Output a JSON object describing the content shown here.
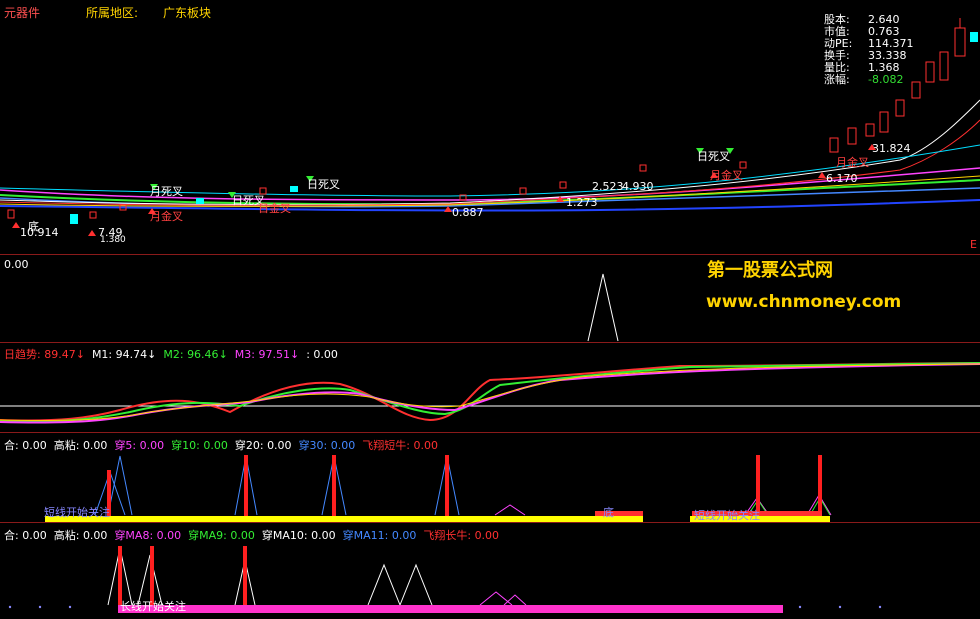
{
  "header": {
    "stock_type": "元器件",
    "region_label": "所属地区:",
    "board": "广东板块"
  },
  "stats": [
    {
      "label": "股本:",
      "value": "2.640",
      "color": "#ffffff"
    },
    {
      "label": "市值:",
      "value": "0.763",
      "color": "#ffffff"
    },
    {
      "label": "动PE:",
      "value": "114.371",
      "color": "#ffffff"
    },
    {
      "label": "换手:",
      "value": "33.338",
      "color": "#ffffff"
    },
    {
      "label": "量比:",
      "value": "1.368",
      "color": "#ffffff"
    },
    {
      "label": "涨幅:",
      "value": "-8.082",
      "color": "#33dd33"
    }
  ],
  "main_chart": {
    "annotations": [
      {
        "text": "月死叉",
        "color": "#ffffff"
      },
      {
        "text": "月金叉",
        "color": "#ff4040"
      },
      {
        "text": "日死叉",
        "color": "#ffffff"
      },
      {
        "text": "日金叉",
        "color": "#ff4040"
      },
      {
        "text": "日死叉",
        "color": "#ffffff"
      },
      {
        "text": "日死叉",
        "color": "#ffffff"
      },
      {
        "text": "月金叉",
        "color": "#ff4040"
      },
      {
        "text": "月金叉",
        "color": "#ff4040"
      },
      {
        "text": "底",
        "color": "#ffffff"
      }
    ],
    "price_labels": [
      "10.914",
      "7.49",
      "1.380",
      "0.887",
      "1.273",
      "2.523",
      "4.930",
      "31.824",
      "6.170"
    ],
    "right_edge_marker": "E"
  },
  "panel1": {
    "value_label": "0.00"
  },
  "watermark": {
    "line1": "第一股票公式网",
    "line2": "www.chnmoney.com"
  },
  "panel2": {
    "items": [
      {
        "label": "日趋势:",
        "value": "89.47",
        "arrow": "↓",
        "color": "#ff3030"
      },
      {
        "label": "M1:",
        "value": "94.74",
        "arrow": "↓",
        "color": "#ffffff"
      },
      {
        "label": "M2:",
        "value": "96.46",
        "arrow": "↓",
        "color": "#33ee33"
      },
      {
        "label": "M3:",
        "value": "97.51",
        "arrow": "↓",
        "color": "#ff44ff"
      },
      {
        "label": ":",
        "value": "0.00",
        "arrow": "",
        "color": "#ffffff"
      }
    ]
  },
  "panel3": {
    "items": [
      {
        "label": "合:",
        "value": "0.00",
        "color": "#ffffff"
      },
      {
        "label": "高粘:",
        "value": "0.00",
        "color": "#ffffff"
      },
      {
        "label": "穿5:",
        "value": "0.00",
        "color": "#ff44ff"
      },
      {
        "label": "穿10:",
        "value": "0.00",
        "color": "#33ee33"
      },
      {
        "label": "穿20:",
        "value": "0.00",
        "color": "#ffffff"
      },
      {
        "label": "穿30:",
        "value": "0.00",
        "color": "#4488ff"
      },
      {
        "label": "飞翔短牛:",
        "value": "0.00",
        "color": "#ff3030"
      }
    ],
    "texts": [
      "短线开始关注",
      "短线开始关注",
      "底"
    ]
  },
  "panel4": {
    "items": [
      {
        "label": "合:",
        "value": "0.00",
        "color": "#ffffff"
      },
      {
        "label": "高粘:",
        "value": "0.00",
        "color": "#ffffff"
      },
      {
        "label": "穿MA8:",
        "value": "0.00",
        "color": "#ff44ff"
      },
      {
        "label": "穿MA9:",
        "value": "0.00",
        "color": "#33ee33"
      },
      {
        "label": "穿MA10:",
        "value": "0.00",
        "color": "#ffffff"
      },
      {
        "label": "穿MA11:",
        "value": "0.00",
        "color": "#4488ff"
      },
      {
        "label": "飞翔长牛:",
        "value": "0.00",
        "color": "#ff3030"
      }
    ],
    "texts": [
      "长线开始关注"
    ]
  }
}
